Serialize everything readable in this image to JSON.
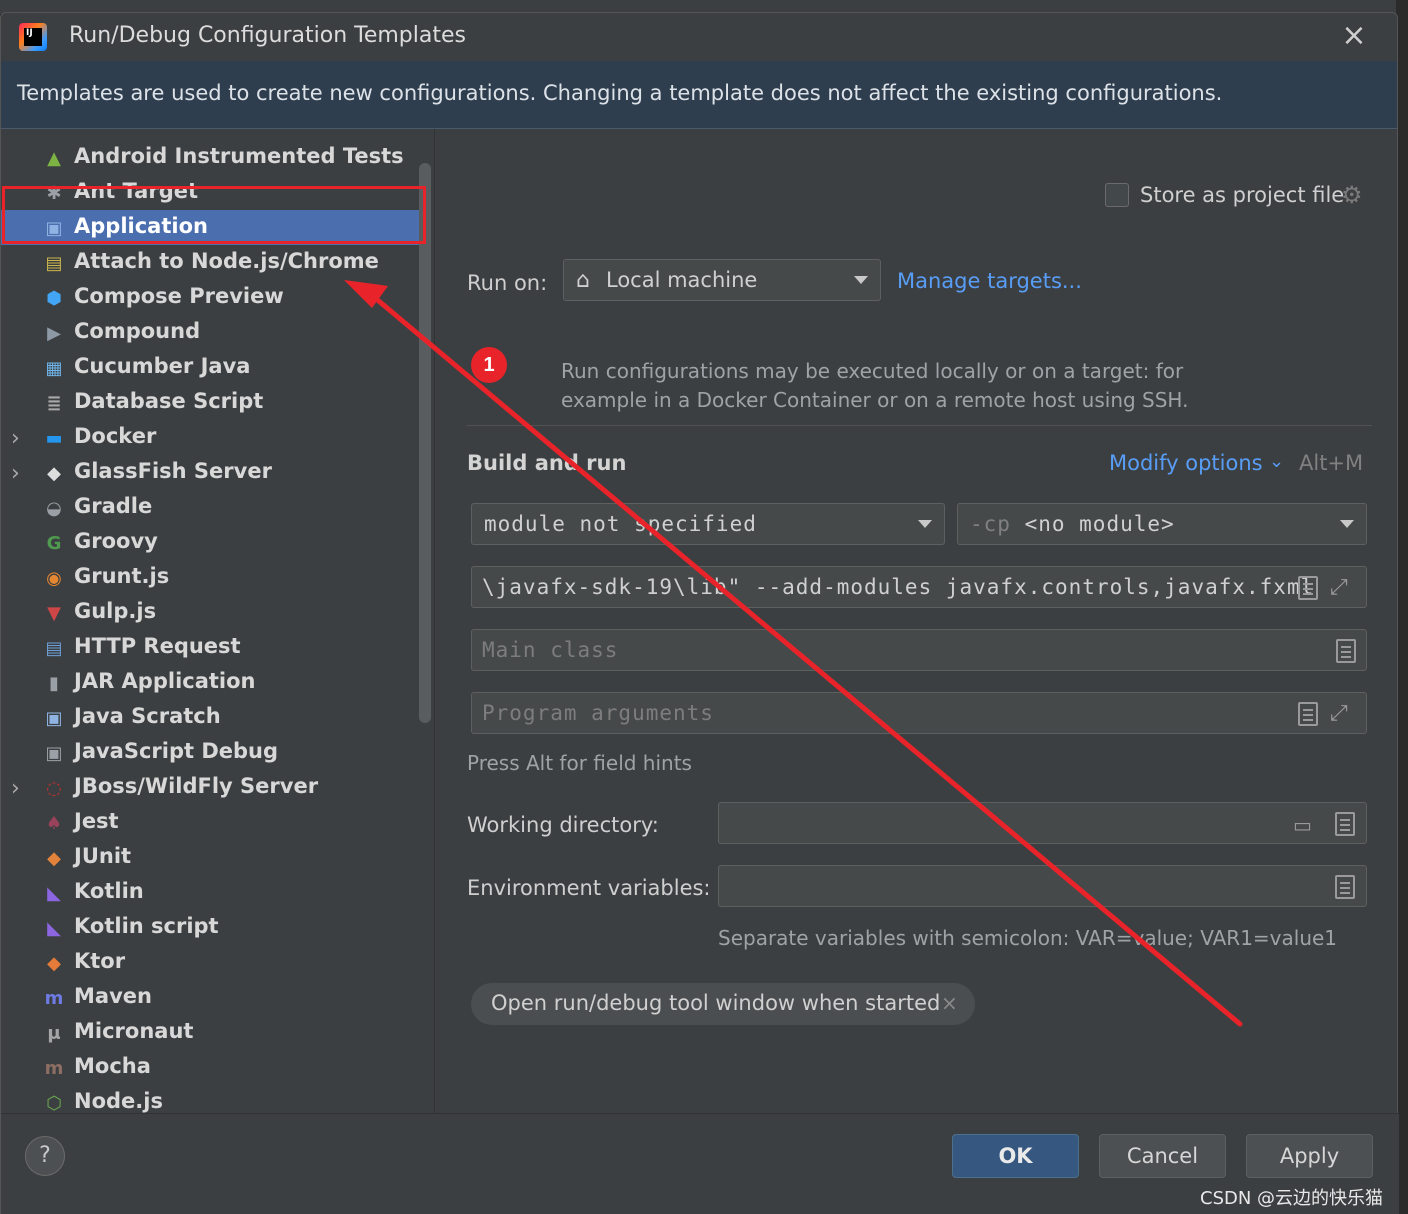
{
  "window": {
    "title": "Run/Debug Configuration Templates",
    "banner": "Templates are used to create new configurations. Changing a template does not affect the existing configurations."
  },
  "sidebar": {
    "items": [
      {
        "label": "Android Instrumented Tests",
        "icon": "android-icon",
        "expandable": false
      },
      {
        "label": "Ant Target",
        "icon": "ant-icon",
        "expandable": false
      },
      {
        "label": "Application",
        "icon": "application-icon",
        "expandable": false,
        "selected": true
      },
      {
        "label": "Attach to Node.js/Chrome",
        "icon": "attach-js-icon",
        "expandable": false
      },
      {
        "label": "Compose Preview",
        "icon": "compose-icon",
        "expandable": false
      },
      {
        "label": "Compound",
        "icon": "compound-icon",
        "expandable": false
      },
      {
        "label": "Cucumber Java",
        "icon": "cucumber-icon",
        "expandable": false
      },
      {
        "label": "Database Script",
        "icon": "database-icon",
        "expandable": false
      },
      {
        "label": "Docker",
        "icon": "docker-icon",
        "expandable": true
      },
      {
        "label": "GlassFish Server",
        "icon": "glassfish-icon",
        "expandable": true
      },
      {
        "label": "Gradle",
        "icon": "gradle-icon",
        "expandable": false
      },
      {
        "label": "Groovy",
        "icon": "groovy-icon",
        "expandable": false
      },
      {
        "label": "Grunt.js",
        "icon": "grunt-icon",
        "expandable": false
      },
      {
        "label": "Gulp.js",
        "icon": "gulp-icon",
        "expandable": false
      },
      {
        "label": "HTTP Request",
        "icon": "http-api-icon",
        "expandable": false
      },
      {
        "label": "JAR Application",
        "icon": "jar-icon",
        "expandable": false
      },
      {
        "label": "Java Scratch",
        "icon": "java-scratch-icon",
        "expandable": false
      },
      {
        "label": "JavaScript Debug",
        "icon": "js-debug-icon",
        "expandable": false
      },
      {
        "label": "JBoss/WildFly Server",
        "icon": "jboss-icon",
        "expandable": true
      },
      {
        "label": "Jest",
        "icon": "jest-icon",
        "expandable": false
      },
      {
        "label": "JUnit",
        "icon": "junit-icon",
        "expandable": false
      },
      {
        "label": "Kotlin",
        "icon": "kotlin-icon",
        "expandable": false
      },
      {
        "label": "Kotlin script",
        "icon": "kotlin-script-icon",
        "expandable": false
      },
      {
        "label": "Ktor",
        "icon": "ktor-icon",
        "expandable": false
      },
      {
        "label": "Maven",
        "icon": "maven-icon",
        "expandable": false
      },
      {
        "label": "Micronaut",
        "icon": "micronaut-icon",
        "expandable": false
      },
      {
        "label": "Mocha",
        "icon": "mocha-icon",
        "expandable": false
      },
      {
        "label": "Node.js",
        "icon": "nodejs-icon",
        "expandable": false
      }
    ]
  },
  "main": {
    "store_label": "Store as project file",
    "run_on_label": "Run on:",
    "run_on_value": "Local machine",
    "manage_targets": "Manage targets...",
    "annotation_number": "1",
    "run_on_hint": "Run configurations may be executed locally or on a target: for example in a Docker Container or on a remote host using SSH.",
    "build_title": "Build and run",
    "modify_options": "Modify options",
    "modify_shortcut": "Alt+M",
    "module_value": "module not specified",
    "cp_flag": "-cp",
    "cp_value": "<no module>",
    "vm_options_value": "\\javafx-sdk-19\\lib\" --add-modules javafx.controls,javafx.fxml",
    "main_class_placeholder": "Main class",
    "program_args_placeholder": "Program arguments",
    "field_hints": "Press Alt for field hints",
    "working_dir_label": "Working directory:",
    "env_vars_label": "Environment variables:",
    "env_vars_hint": "Separate variables with semicolon: VAR=value; VAR1=value1",
    "open_tool_window_chip": "Open run/debug tool window when started"
  },
  "footer": {
    "help": "?",
    "ok": "OK",
    "cancel": "Cancel",
    "apply": "Apply"
  },
  "watermark": "CSDN @云边的快乐猫",
  "colors": {
    "accent": "#589df6",
    "selection": "#4b6eaf",
    "annotation_red": "#e8242a"
  }
}
